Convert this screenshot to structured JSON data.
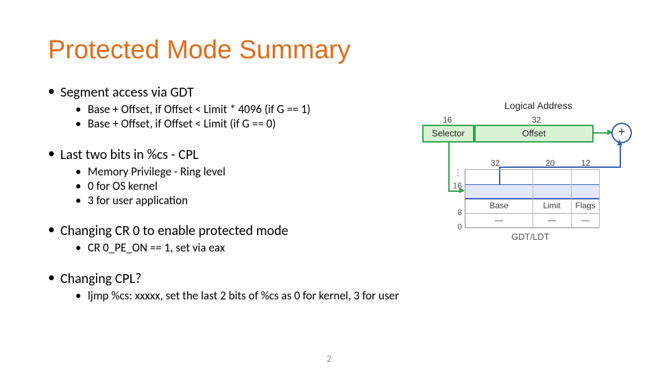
{
  "title": "Protected Mode Summary",
  "page_number": "2",
  "bullets": [
    {
      "text": "Segment access via GDT",
      "sub": [
        "Base + Offset, if Offset < Limit * 4096 (if G == 1)",
        "Base + Offset, if Offset < Limit (if G == 0)"
      ]
    },
    {
      "text": "Last two bits in %cs - CPL",
      "sub": [
        "Memory Privilege - Ring level",
        "0 for OS kernel",
        "3 for user application"
      ]
    },
    {
      "text": "Changing CR 0 to enable protected mode",
      "sub": [
        "CR 0_PE_ON == 1, set via eax"
      ]
    },
    {
      "text": "Changing CPL?",
      "sub": [
        "ljmp %cs: xxxxx, set the last 2 bits of %cs as 0 for kernel, 3 for user"
      ]
    }
  ],
  "diagram": {
    "logical_address_label": "Logical Address",
    "selector_label": "Selector",
    "offset_label": "Offset",
    "selector_bits": "16",
    "offset_bits": "32",
    "plus_symbol": "+",
    "col_bits": {
      "base": "32",
      "limit": "20",
      "flags": "12"
    },
    "cols": {
      "base": "Base",
      "limit": "Limit",
      "flags": "Flags"
    },
    "cell_placeholder": "—",
    "y_ticks": {
      "t0": "0",
      "t8": "8",
      "t16": "16"
    },
    "y_dots": "⋮",
    "table_caption": "GDT/LDT"
  }
}
